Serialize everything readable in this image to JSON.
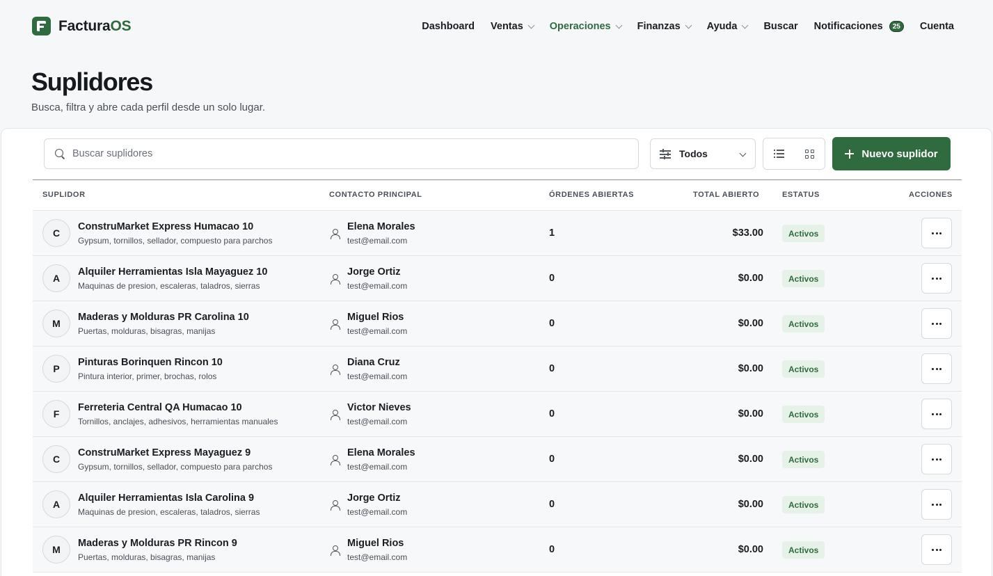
{
  "nav": {
    "logo_main": "Factura",
    "logo_accent": "OS",
    "items": [
      {
        "label": "Dashboard",
        "dropdown": false,
        "active": false
      },
      {
        "label": "Ventas",
        "dropdown": true,
        "active": false
      },
      {
        "label": "Operaciones",
        "dropdown": true,
        "active": true
      },
      {
        "label": "Finanzas",
        "dropdown": true,
        "active": false
      },
      {
        "label": "Ayuda",
        "dropdown": true,
        "active": false
      },
      {
        "label": "Buscar",
        "dropdown": false,
        "active": false
      }
    ],
    "notifications_label": "Notificaciones",
    "notifications_count": "25",
    "account_label": "Cuenta"
  },
  "header": {
    "title": "Suplidores",
    "subtitle": "Busca, filtra y abre cada perfil desde un solo lugar."
  },
  "toolbar": {
    "search_placeholder": "Buscar suplidores",
    "search_value": "",
    "filter_label": "Todos",
    "new_label": "Nuevo suplidor"
  },
  "table": {
    "headers": {
      "supplier": "SUPLIDOR",
      "contact": "CONTACTO PRINCIPAL",
      "orders": "ÓRDENES ABIERTAS",
      "total": "TOTAL ABIERTO",
      "status": "ESTATUS",
      "actions": "ACCIONES"
    },
    "rows": [
      {
        "initial": "C",
        "name": "ConstruMarket Express Humacao 10",
        "desc": "Gypsum, tornillos, sellador, compuesto para parchos",
        "contact": "Elena Morales",
        "email": "test@email.com",
        "orders": "1",
        "total": "$33.00",
        "status": "Activos"
      },
      {
        "initial": "A",
        "name": "Alquiler Herramientas Isla Mayaguez 10",
        "desc": "Maquinas de presion, escaleras, taladros, sierras",
        "contact": "Jorge Ortiz",
        "email": "test@email.com",
        "orders": "0",
        "total": "$0.00",
        "status": "Activos"
      },
      {
        "initial": "M",
        "name": "Maderas y Molduras PR Carolina 10",
        "desc": "Puertas, molduras, bisagras, manijas",
        "contact": "Miguel Rios",
        "email": "test@email.com",
        "orders": "0",
        "total": "$0.00",
        "status": "Activos"
      },
      {
        "initial": "P",
        "name": "Pinturas Borinquen Rincon 10",
        "desc": "Pintura interior, primer, brochas, rolos",
        "contact": "Diana Cruz",
        "email": "test@email.com",
        "orders": "0",
        "total": "$0.00",
        "status": "Activos"
      },
      {
        "initial": "F",
        "name": "Ferreteria Central QA Humacao 10",
        "desc": "Tornillos, anclajes, adhesivos, herramientas manuales",
        "contact": "Victor Nieves",
        "email": "test@email.com",
        "orders": "0",
        "total": "$0.00",
        "status": "Activos"
      },
      {
        "initial": "C",
        "name": "ConstruMarket Express Mayaguez 9",
        "desc": "Gypsum, tornillos, sellador, compuesto para parchos",
        "contact": "Elena Morales",
        "email": "test@email.com",
        "orders": "0",
        "total": "$0.00",
        "status": "Activos"
      },
      {
        "initial": "A",
        "name": "Alquiler Herramientas Isla Carolina 9",
        "desc": "Maquinas de presion, escaleras, taladros, sierras",
        "contact": "Jorge Ortiz",
        "email": "test@email.com",
        "orders": "0",
        "total": "$0.00",
        "status": "Activos"
      },
      {
        "initial": "M",
        "name": "Maderas y Molduras PR Rincon 9",
        "desc": "Puertas, molduras, bisagras, manijas",
        "contact": "Miguel Rios",
        "email": "test@email.com",
        "orders": "0",
        "total": "$0.00",
        "status": "Activos"
      }
    ]
  },
  "icons": {
    "logo": "facturaos-logo-icon",
    "search": "search-icon",
    "filter": "sliders-icon",
    "list_view": "list-icon",
    "grid_view": "grid-icon",
    "add": "plus-icon",
    "contact": "user-icon",
    "more": "more-horizontal-icon",
    "dropdown": "chevron-down-icon"
  },
  "colors": {
    "brand": "#2f6b3f",
    "status_bg": "#e6f2e8",
    "page_bg": "#f6f7f9"
  }
}
